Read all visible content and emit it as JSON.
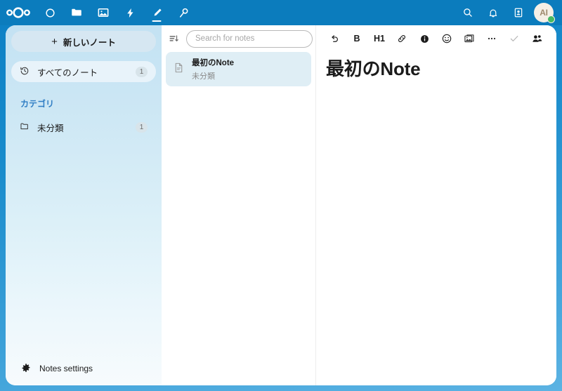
{
  "header": {
    "logo_name": "nextcloud-logo",
    "apps": [
      {
        "name": "dashboard-app-icon",
        "label": "Dashboard",
        "active": false
      },
      {
        "name": "files-app-icon",
        "label": "Files",
        "active": false
      },
      {
        "name": "photos-app-icon",
        "label": "Photos",
        "active": false
      },
      {
        "name": "activity-app-icon",
        "label": "Activity",
        "active": false
      },
      {
        "name": "notes-app-icon",
        "label": "Notes",
        "active": true
      },
      {
        "name": "passwords-app-icon",
        "label": "Passwords",
        "active": false
      }
    ],
    "actions": [
      {
        "name": "search-icon",
        "label": "Search"
      },
      {
        "name": "notifications-bell-icon",
        "label": "Notifications"
      },
      {
        "name": "contacts-icon",
        "label": "Contacts"
      }
    ],
    "avatar": {
      "initials": "AI",
      "status": "online",
      "status_color": "#46ba61"
    },
    "background_color": "#0b7cbd"
  },
  "sidebar": {
    "new_note_label": "新しいノート",
    "new_note_plus": "+",
    "all_notes": {
      "label": "すべてのノート",
      "count": "1",
      "icon": "history-clock-icon",
      "selected": true
    },
    "category_heading": "カテゴリ",
    "categories": [
      {
        "label": "未分類",
        "count": "1",
        "icon": "folder-icon"
      }
    ],
    "settings": {
      "label": "Notes settings",
      "icon": "gear-icon"
    }
  },
  "notes_list": {
    "sort_icon": "sort-order-icon",
    "search": {
      "value": "",
      "placeholder": "Search for notes"
    },
    "notes": [
      {
        "title": "最初のNote",
        "category": "未分類",
        "icon": "note-document-icon",
        "selected": true
      }
    ]
  },
  "editor": {
    "toolbar": [
      {
        "name": "undo-icon",
        "label": "Undo",
        "kind": "icon"
      },
      {
        "name": "bold-button",
        "label": "B",
        "kind": "text"
      },
      {
        "name": "heading1-button",
        "label": "H1",
        "kind": "text"
      },
      {
        "name": "link-icon",
        "label": "Link",
        "kind": "icon"
      },
      {
        "name": "info-icon",
        "label": "Info",
        "kind": "icon"
      },
      {
        "name": "emoji-icon",
        "label": "Emoji",
        "kind": "icon"
      },
      {
        "name": "image-icon",
        "label": "Insert image",
        "kind": "icon"
      },
      {
        "name": "more-actions-icon",
        "label": "…",
        "kind": "icon"
      }
    ],
    "right_actions": [
      {
        "name": "saved-check-icon",
        "label": "Saved"
      },
      {
        "name": "share-people-icon",
        "label": "Share"
      }
    ],
    "note_heading": "最初のNote",
    "content": ""
  },
  "colors": {
    "brand_blue": "#0b7cbd",
    "sidebar_top": "#c3e2f3",
    "selection": "#dfeef5",
    "accent_text": "#2f7ec4"
  }
}
